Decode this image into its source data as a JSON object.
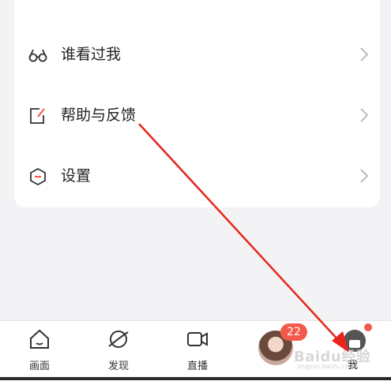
{
  "menu": {
    "items": [
      {
        "label": "谁看过我",
        "icon": "glasses-icon"
      },
      {
        "label": "帮助与反馈",
        "icon": "edit-note-icon"
      },
      {
        "label": "设置",
        "icon": "hexagon-settings-icon"
      }
    ]
  },
  "tabbar": {
    "tabs": [
      {
        "label": "画面",
        "icon": "home-icon"
      },
      {
        "label": "发现",
        "icon": "planet-icon"
      },
      {
        "label": "直播",
        "icon": "video-camera-icon"
      }
    ],
    "story_badge": "22",
    "me_label": "我"
  },
  "watermark": {
    "text": "Baidu经验",
    "sub": "jingyan.baidu.com"
  },
  "colors": {
    "accent": "#f45a4b",
    "annotation_arrow": "#e8241c"
  }
}
